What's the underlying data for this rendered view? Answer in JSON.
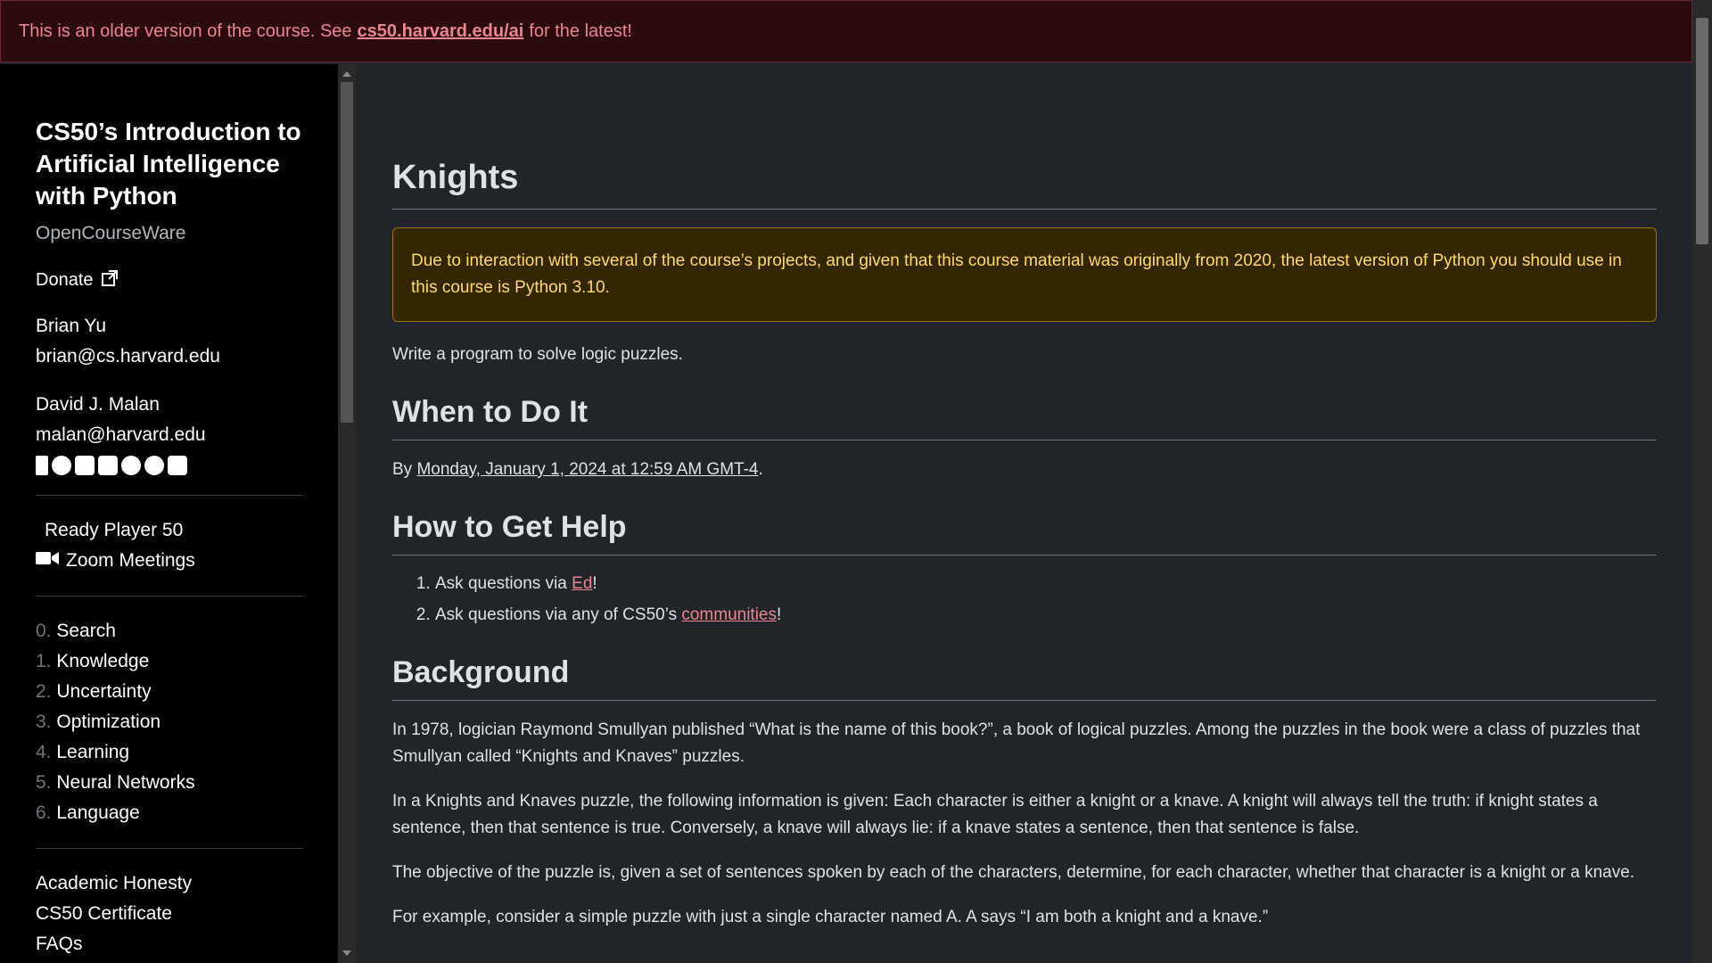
{
  "banner": {
    "prefix": "This is an older version of the course. See",
    "link": "cs50.harvard.edu/ai",
    "suffix": "for the latest!"
  },
  "sidebar": {
    "title": "CS50’s Introduction to Artificial Intelligence with Python",
    "subtitle": "OpenCourseWare",
    "donate": "Donate",
    "people": [
      {
        "name": "Brian Yu",
        "email": "brian@cs.harvard.edu"
      },
      {
        "name": "David J. Malan",
        "email": "malan@harvard.edu"
      }
    ],
    "social_icons": [
      "facebook-icon",
      "github-icon",
      "instagram-icon",
      "linkedin-icon",
      "reddit-icon",
      "threads-icon",
      "twitter-icon"
    ],
    "extras": [
      {
        "label": "Ready Player 50"
      },
      {
        "label": "Zoom Meetings",
        "icon": "video-camera-icon"
      }
    ],
    "lectures": [
      {
        "num": "0.",
        "label": "Search"
      },
      {
        "num": "1.",
        "label": "Knowledge"
      },
      {
        "num": "2.",
        "label": "Uncertainty"
      },
      {
        "num": "3.",
        "label": "Optimization"
      },
      {
        "num": "4.",
        "label": "Learning"
      },
      {
        "num": "5.",
        "label": "Neural Networks"
      },
      {
        "num": "6.",
        "label": "Language"
      }
    ],
    "footer_links": [
      "Academic Honesty",
      "CS50 Certificate",
      "FAQs"
    ]
  },
  "main": {
    "title": "Knights",
    "alert": "Due to interaction with several of the course’s projects, and given that this course material was originally from 2020, the latest version of Python you should use in this course is Python 3.10.",
    "intro": "Write a program to solve logic puzzles.",
    "when": {
      "heading": "When to Do It",
      "prefix": "By",
      "date": "Monday, January 1, 2024 at 12:59 AM GMT-4",
      "suffix": "."
    },
    "help": {
      "heading": "How to Get Help",
      "item1_prefix": "Ask questions via",
      "item1_link": "Ed",
      "item1_suffix": "!",
      "item2_prefix": "Ask questions via any of CS50’s",
      "item2_link": "communities",
      "item2_suffix": "!"
    },
    "background": {
      "heading": "Background",
      "paragraphs": [
        "In 1978, logician Raymond Smullyan published “What is the name of this book?”, a book of logical puzzles. Among the puzzles in the book were a class of puzzles that Smullyan called “Knights and Knaves” puzzles.",
        "In a Knights and Knaves puzzle, the following information is given: Each character is either a knight or a knave. A knight will always tell the truth: if knight states a sentence, then that sentence is true. Conversely, a knave will always lie: if a knave states a sentence, then that sentence is false.",
        "The objective of the puzzle is, given a set of sentences spoken by each of the characters, determine, for each character, whether that character is a knight or a knave.",
        "For example, consider a simple puzzle with just a single character named A. A says “I am both a knight and a knave.”"
      ]
    }
  },
  "colors": {
    "banner_bg": "#2c0b0e",
    "banner_text": "#ea868f",
    "alert_bg": "#332701",
    "alert_text": "#ffda6a",
    "page_bg": "#212529",
    "sidebar_bg": "#000000"
  }
}
